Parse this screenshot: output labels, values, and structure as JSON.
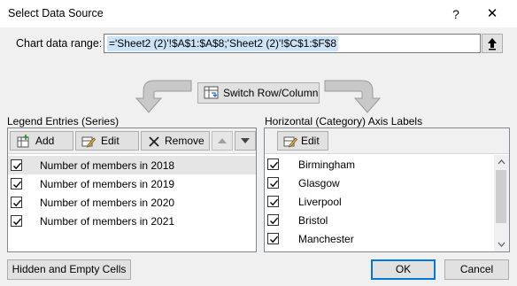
{
  "dialog": {
    "title": "Select Data Source",
    "help": "?",
    "close": "✕"
  },
  "range": {
    "label": "Chart data range:",
    "value": "='Sheet2 (2)'!$A$1:$A$8;'Sheet2 (2)'!$C$1:$F$8"
  },
  "switch": {
    "label": "Switch Row/Column"
  },
  "legend": {
    "title": "Legend Entries (Series)",
    "add": "Add",
    "edit": "Edit",
    "remove": "Remove",
    "items": [
      {
        "label": "Number of members in 2018",
        "checked": true,
        "selected": true
      },
      {
        "label": "Number of members in 2019",
        "checked": true,
        "selected": false
      },
      {
        "label": "Number of members in 2020",
        "checked": true,
        "selected": false
      },
      {
        "label": "Number of members in 2021",
        "checked": true,
        "selected": false
      }
    ]
  },
  "axis": {
    "title": "Horizontal (Category) Axis Labels",
    "edit": "Edit",
    "items": [
      {
        "label": "Birmingham",
        "checked": true
      },
      {
        "label": "Glasgow",
        "checked": true
      },
      {
        "label": "Liverpool",
        "checked": true
      },
      {
        "label": "Bristol",
        "checked": true
      },
      {
        "label": "Manchester",
        "checked": true
      }
    ]
  },
  "footer": {
    "hidden_cells": "Hidden and Empty Cells",
    "ok": "OK",
    "cancel": "Cancel"
  },
  "colors": {
    "accent": "#0078d7",
    "selection": "#cce4f7"
  }
}
